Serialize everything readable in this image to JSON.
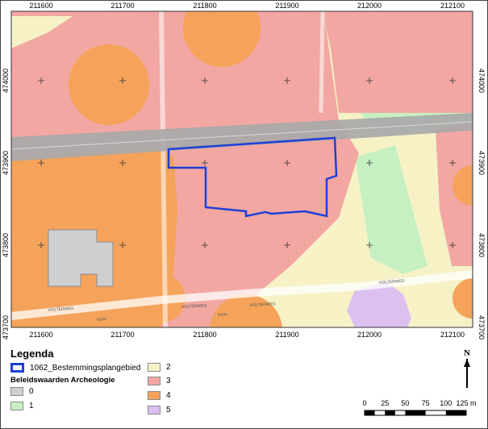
{
  "map": {
    "x_ticks": [
      "211600",
      "211700",
      "211800",
      "211900",
      "212000",
      "212100"
    ],
    "y_ticks_left": [
      "474000",
      "473900",
      "473800",
      "473700"
    ],
    "y_ticks_right": [
      "474000",
      "473900",
      "473800",
      "473700"
    ],
    "street_labels": [
      "HOLTERWEG",
      "HOLTERWEG",
      "HOLTERWEG",
      "N344",
      "N344",
      "HOLTERWEG"
    ],
    "colors": {
      "class_0": "#cfcfcf",
      "class_1": "#c6f0c2",
      "class_2": "#f6f2c6",
      "class_3": "#f2a7a2",
      "class_4": "#f5a35a",
      "class_5": "#dcc0f0",
      "boundary": "#1f3fd6",
      "railway": "#a9a9a9"
    }
  },
  "legend": {
    "title": "Legenda",
    "boundary_label": "1062_Bestemmingsplangebied",
    "category_title": "Beleidswaarden Archeologie",
    "items": [
      {
        "label": "0",
        "color": "#cfcfcf"
      },
      {
        "label": "1",
        "color": "#c6f0c2"
      },
      {
        "label": "2",
        "color": "#f6f2c6"
      },
      {
        "label": "3",
        "color": "#f2a7a2"
      },
      {
        "label": "4",
        "color": "#f5a35a"
      },
      {
        "label": "5",
        "color": "#dcc0f0"
      }
    ]
  },
  "north_arrow": {
    "label": "N"
  },
  "scale_bar": {
    "labels": [
      "0",
      "25",
      "50",
      "75",
      "100",
      "125 m"
    ]
  }
}
